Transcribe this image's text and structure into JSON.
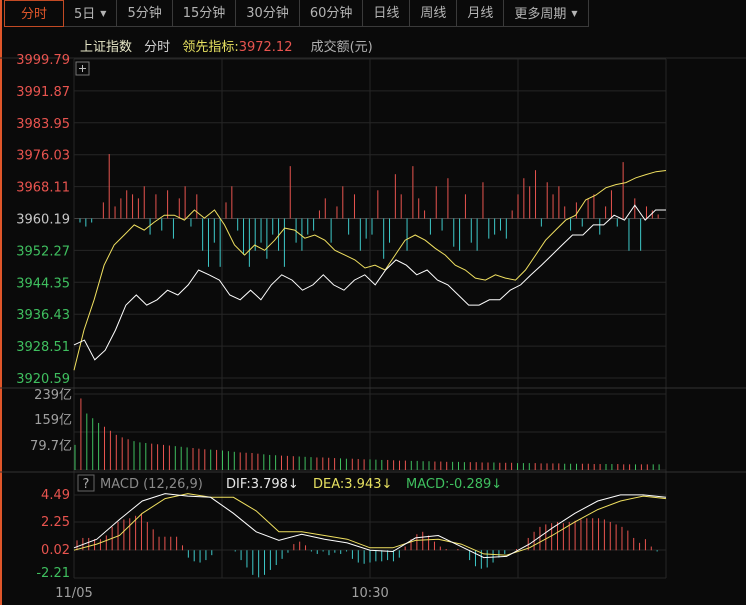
{
  "tabs": [
    {
      "label": "分时",
      "active": true
    },
    {
      "label": "5日",
      "dropdown": true
    },
    {
      "label": "5分钟"
    },
    {
      "label": "15分钟"
    },
    {
      "label": "30分钟"
    },
    {
      "label": "60分钟"
    },
    {
      "label": "日线"
    },
    {
      "label": "周线"
    },
    {
      "label": "月线"
    },
    {
      "label": "更多周期",
      "dropdown": true
    }
  ],
  "header": {
    "name": "上证指数",
    "mode": "分时",
    "lead_label": "领先指标:",
    "lead_value": "3972.12",
    "volume_label": "成交额(元)"
  },
  "price_axis": [
    "3999.79",
    "3991.87",
    "3983.95",
    "3976.03",
    "3968.11",
    "3960.19",
    "3952.27",
    "3944.35",
    "3936.43",
    "3928.51",
    "3920.59"
  ],
  "volume_axis": [
    "239亿",
    "159亿",
    "79.7亿"
  ],
  "macd_axis": [
    "4.49",
    "2.25",
    "0.02",
    "-2.21"
  ],
  "time_axis": [
    "11/05",
    "10:30"
  ],
  "macd_legend": {
    "help": "?",
    "name": "MACD (12,26,9)",
    "dif": "DIF:3.798↓",
    "dea": "DEA:3.943↓",
    "macd": "MACD:-0.289↓"
  },
  "colors": {
    "up": "#e8544f",
    "down": "#3ec9c9",
    "vol_down": "#3fbf5f",
    "price": "#ffffff",
    "lead": "#f0e060",
    "accent": "#e0562a"
  },
  "chart_data": {
    "type": "line",
    "price_range": [
      3920.59,
      3999.79
    ],
    "prev_close": 3960.19,
    "price": [
      3928.8,
      3930.0,
      3925.1,
      3927.5,
      3932.5,
      3938.7,
      3941.2,
      3938.7,
      3940.0,
      3942.4,
      3941.2,
      3943.7,
      3947.4,
      3946.2,
      3944.9,
      3941.2,
      3940.0,
      3942.4,
      3940.0,
      3943.7,
      3946.2,
      3944.9,
      3942.4,
      3943.7,
      3946.2,
      3943.7,
      3942.4,
      3944.9,
      3946.2,
      3943.7,
      3947.4,
      3949.9,
      3948.6,
      3946.2,
      3947.4,
      3944.9,
      3943.7,
      3941.2,
      3938.7,
      3938.7,
      3940.0,
      3940.0,
      3942.4,
      3943.7,
      3946.2,
      3948.6,
      3951.1,
      3953.6,
      3956.1,
      3956.1,
      3958.6,
      3958.6,
      3961.0,
      3959.8,
      3963.5,
      3959.8,
      3962.3,
      3962.3
    ],
    "lead": [
      3922.5,
      3932.5,
      3940.0,
      3948.6,
      3953.6,
      3956.1,
      3958.6,
      3957.3,
      3959.3,
      3961.0,
      3961.0,
      3959.8,
      3962.3,
      3960.3,
      3962.3,
      3958.6,
      3953.6,
      3951.1,
      3953.6,
      3952.3,
      3954.8,
      3957.8,
      3957.3,
      3955.3,
      3956.1,
      3954.8,
      3952.3,
      3951.1,
      3949.9,
      3947.9,
      3948.6,
      3947.4,
      3951.1,
      3954.8,
      3956.1,
      3954.8,
      3952.8,
      3951.1,
      3948.6,
      3947.4,
      3945.4,
      3944.9,
      3946.2,
      3945.4,
      3944.9,
      3947.4,
      3951.1,
      3954.8,
      3957.3,
      3959.8,
      3961.0,
      3964.8,
      3966.0,
      3967.8,
      3968.6,
      3969.1,
      3970.3,
      3971.1,
      3971.8,
      3972.1
    ],
    "price_bars": [
      -1,
      -2,
      -1,
      0,
      4,
      16,
      3,
      5,
      7,
      6,
      5,
      8,
      -4,
      6,
      -3,
      7,
      -5,
      5,
      8,
      -2,
      6,
      -8,
      -12,
      -6,
      -12,
      4,
      8,
      -3,
      -9,
      -12,
      -8,
      -6,
      -10,
      -4,
      -8,
      -12,
      13,
      -6,
      -8,
      -4,
      -3,
      2,
      5,
      -6,
      3,
      8,
      -4,
      6,
      -8,
      -5,
      -4,
      7,
      -10,
      -6,
      11,
      6,
      -8,
      13,
      5,
      2,
      -4,
      8,
      -3,
      10,
      -7,
      -8,
      6,
      -6,
      -8,
      9,
      -5,
      -4,
      -3,
      -5,
      2,
      6,
      10,
      8,
      12,
      -2,
      9,
      6,
      8,
      3,
      -3,
      4,
      -2,
      5,
      6,
      -4,
      3,
      7,
      -2,
      14,
      -8,
      5,
      -8,
      3,
      2,
      1
    ],
    "volume_unit": "亿",
    "volume": [
      80,
      228,
      180,
      165,
      150,
      138,
      125,
      112,
      104,
      98,
      92,
      88,
      86,
      84,
      82,
      80,
      78,
      76,
      74,
      72,
      70,
      68,
      66,
      65,
      64,
      62,
      60,
      58,
      56,
      55,
      54,
      52,
      50,
      48,
      47,
      46,
      45,
      44,
      43,
      42,
      41,
      40,
      40,
      39,
      38,
      37,
      36,
      36,
      35,
      34,
      34,
      33,
      32,
      32,
      31,
      30,
      30,
      29,
      29,
      28,
      28,
      27,
      27,
      26,
      26,
      26,
      25,
      25,
      25,
      24,
      24,
      24,
      23,
      23,
      23,
      22,
      22,
      22,
      22,
      21,
      21,
      21,
      21,
      20,
      20,
      20,
      20,
      20,
      19,
      19,
      19,
      19,
      19,
      18,
      18,
      18,
      18,
      18,
      18,
      18
    ],
    "volume_up": "grgggrrrrrgggrrrrgggrrrgrgggrrrrgggrrrgggrrrrggrrrgggrrrrggggrrrgggrrrrgrrrgggrrrrrgggrrrrggrrrgrrg",
    "macd_range": [
      -2.21,
      4.49
    ],
    "macd_hist": [
      0.8,
      1.0,
      1.0,
      0.9,
      0.9,
      1.2,
      1.9,
      2.3,
      2.5,
      2.6,
      2.8,
      3.0,
      2.3,
      1.7,
      1.1,
      1.1,
      1.1,
      1.1,
      0.4,
      -0.6,
      -0.9,
      -1.0,
      -0.8,
      -0.4,
      0,
      0,
      0,
      -0.1,
      -0.8,
      -1.4,
      -2.0,
      -2.2,
      -2.0,
      -1.6,
      -1.2,
      -0.7,
      -0.2,
      0.5,
      0.7,
      0.4,
      -0.1,
      -0.3,
      -0.1,
      -0.4,
      -0.2,
      -0.3,
      -0.1,
      -0.7,
      -1.0,
      -1.1,
      -1.0,
      -0.9,
      -0.9,
      -0.8,
      -0.9,
      -0.6,
      0.3,
      0.9,
      1.3,
      1.5,
      1.2,
      0.7,
      0.3,
      0.1,
      0,
      0.1,
      0,
      -0.8,
      -1.3,
      -1.5,
      -1.4,
      -1.0,
      -0.6,
      -0.3,
      0,
      0.1,
      0,
      1.0,
      1.5,
      1.9,
      2.1,
      2.2,
      2.3,
      2.2,
      2.3,
      2.4,
      2.5,
      2.6,
      2.6,
      2.6,
      2.5,
      2.3,
      2.1,
      1.9,
      1.6,
      1.0,
      0.6,
      0.9,
      0.3,
      -0.1
    ],
    "dif": [
      0.2,
      0.9,
      2.5,
      4.0,
      4.6,
      4.4,
      4.3,
      3.0,
      1.5,
      0.8,
      1.3,
      0.9,
      0.6,
      0.0,
      -0.1,
      1.0,
      1.2,
      0.3,
      -0.6,
      -0.5,
      0.5,
      1.8,
      3.0,
      4.0,
      4.5,
      4.5,
      4.3
    ],
    "dea": [
      0.0,
      0.5,
      1.2,
      3.0,
      4.2,
      4.6,
      4.3,
      4.3,
      3.2,
      1.5,
      1.5,
      1.2,
      0.9,
      0.2,
      0.2,
      0.8,
      0.9,
      0.5,
      -0.3,
      -0.4,
      0.2,
      1.2,
      2.3,
      3.3,
      4.0,
      4.4,
      4.2
    ]
  }
}
